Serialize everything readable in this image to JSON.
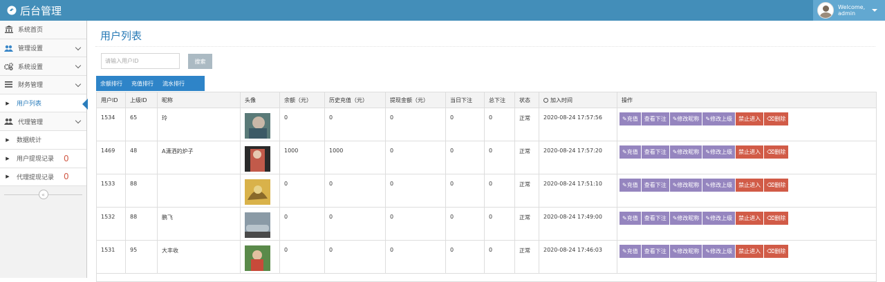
{
  "app": {
    "title": "后台管理"
  },
  "user": {
    "welcome": "Welcome,",
    "name": "admin"
  },
  "sidebar": {
    "items": [
      {
        "label": "系统首页",
        "icon": "bank-icon"
      },
      {
        "label": "管理设置",
        "icon": "users-icon"
      },
      {
        "label": "系统设置",
        "icon": "gears-icon"
      },
      {
        "label": "财务管理",
        "icon": "list-icon"
      },
      {
        "label": "用户列表",
        "icon": "caret-right-icon"
      },
      {
        "label": "代理管理",
        "icon": "users-icon"
      },
      {
        "label": "数据统计",
        "icon": "caret-right-icon"
      },
      {
        "label": "用户提现记录",
        "icon": "caret-right-icon",
        "count": "0"
      },
      {
        "label": "代理提现记录",
        "icon": "caret-right-icon",
        "count": "0"
      }
    ]
  },
  "page": {
    "title": "用户列表"
  },
  "search": {
    "placeholder": "请输入用户ID",
    "button": "搜索"
  },
  "rank_tabs": [
    "余额排行",
    "充值排行",
    "流水排行"
  ],
  "table": {
    "headers": [
      "用户ID",
      "上级ID",
      "昵称",
      "头像",
      "余额（元）",
      "历史充值（元）",
      "提现金额（元）",
      "当日下注",
      "总下注",
      "状态",
      "加入时间",
      "操作"
    ],
    "rows": [
      {
        "id": "1534",
        "parent": "65",
        "nick": "玲",
        "balance": "0",
        "recharge": "0",
        "withdraw": "0",
        "today_bet": "0",
        "total_bet": "0",
        "status": "正常",
        "joined": "2020-08-24 17:57:56"
      },
      {
        "id": "1469",
        "parent": "48",
        "nick": "A潇洒的炉子",
        "balance": "1000",
        "recharge": "1000",
        "withdraw": "0",
        "today_bet": "0",
        "total_bet": "0",
        "status": "正常",
        "joined": "2020-08-24 17:57:20"
      },
      {
        "id": "1533",
        "parent": "88",
        "nick": "",
        "balance": "0",
        "recharge": "0",
        "withdraw": "0",
        "today_bet": "0",
        "total_bet": "0",
        "status": "正常",
        "joined": "2020-08-24 17:51:10"
      },
      {
        "id": "1532",
        "parent": "88",
        "nick": "鹏飞",
        "balance": "0",
        "recharge": "0",
        "withdraw": "0",
        "today_bet": "0",
        "total_bet": "0",
        "status": "正常",
        "joined": "2020-08-24 17:49:00"
      },
      {
        "id": "1531",
        "parent": "95",
        "nick": "大丰收",
        "balance": "0",
        "recharge": "0",
        "withdraw": "0",
        "today_bet": "0",
        "total_bet": "0",
        "status": "正常",
        "joined": "2020-08-24 17:46:03"
      }
    ],
    "actions": {
      "recharge": "充值",
      "view_bets": "查看下注",
      "edit_nick": "修改昵称",
      "edit_parent": "修改上级",
      "ban": "禁止进入",
      "delete": "删除"
    }
  },
  "colors": {
    "topbar": "#438eb9",
    "accent": "#2e84c8",
    "purple": "#9585bf",
    "red": "#d15b47"
  }
}
